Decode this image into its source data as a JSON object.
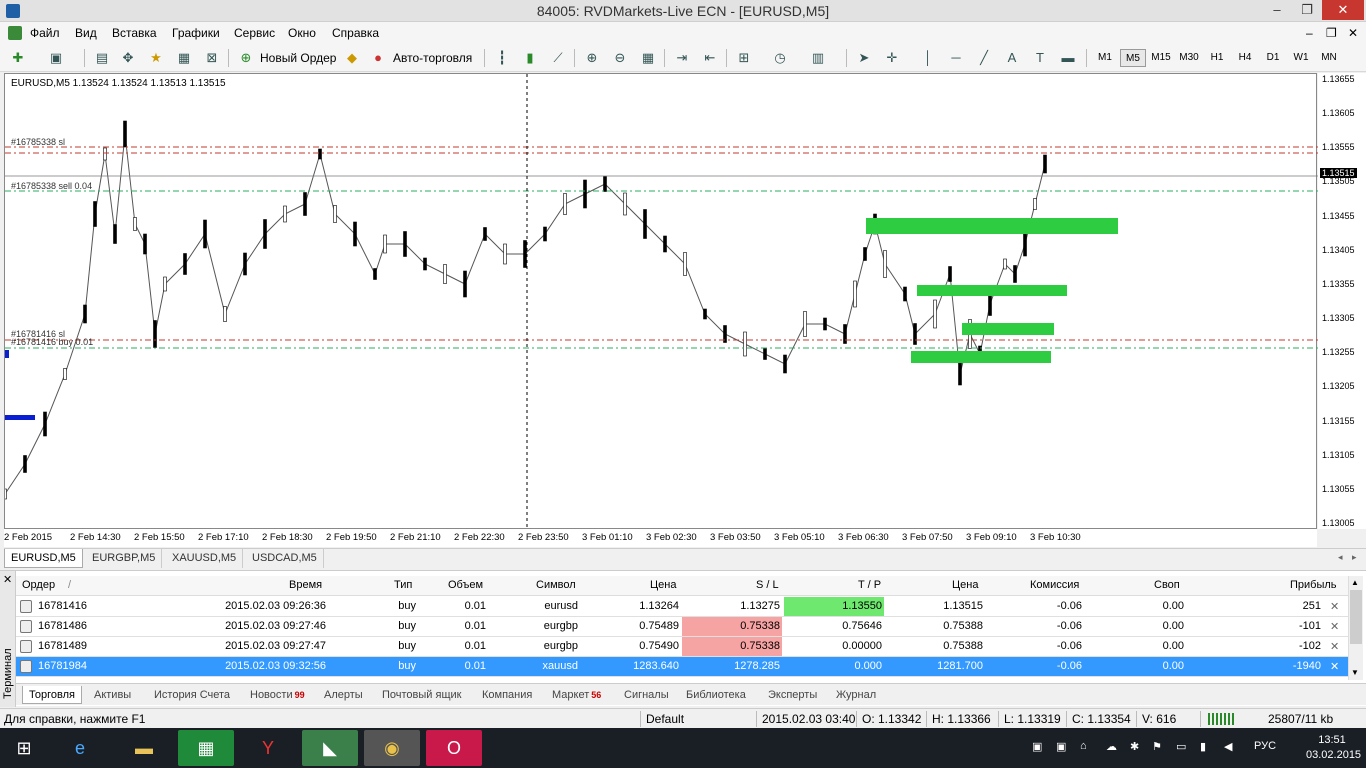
{
  "window": {
    "title": "84005: RVDMarkets-Live ECN - [EURUSD,M5]",
    "minimize": "–",
    "restore": "❐",
    "close": "✕"
  },
  "menu": [
    "Файл",
    "Вид",
    "Вставка",
    "Графики",
    "Сервис",
    "Окно",
    "Справка"
  ],
  "toolbar": {
    "new_order": "Новый Ордер",
    "auto_trading": "Авто-торговля",
    "timeframes": [
      "M1",
      "M5",
      "M15",
      "M30",
      "H1",
      "H4",
      "D1",
      "W1",
      "MN"
    ],
    "active_timeframe": "M5"
  },
  "chart": {
    "symbol_info": "EURUSD,M5  1.13524 1.13524 1.13513 1.13515",
    "current_price": "1.13515",
    "price_labels": [
      "1.13655",
      "1.13605",
      "1.13555",
      "1.13505",
      "1.13455",
      "1.13405",
      "1.13355",
      "1.13305",
      "1.13255",
      "1.13205",
      "1.13155",
      "1.13105",
      "1.13055",
      "1.13005"
    ],
    "time_labels": [
      "2 Feb 2015",
      "2 Feb 14:30",
      "2 Feb 15:50",
      "2 Feb 17:10",
      "2 Feb 18:30",
      "2 Feb 19:50",
      "2 Feb 21:10",
      "2 Feb 22:30",
      "2 Feb 23:50",
      "3 Feb 01:10",
      "3 Feb 02:30",
      "3 Feb 03:50",
      "3 Feb 05:10",
      "3 Feb 06:30",
      "3 Feb 07:50",
      "3 Feb 09:10",
      "3 Feb 10:30"
    ],
    "order_labels": [
      "#16785338 sl",
      "#16785338 sell 0.04",
      "#16781416 sl",
      "#16781416 buy 0.01"
    ],
    "colors": {
      "bull": "#000000",
      "bear": "#000000",
      "zone": "#2ecc40",
      "sl_line": "#c0392b",
      "entry_line": "#27ae60"
    }
  },
  "chart_tabs": [
    "EURUSD,M5",
    "EURGBP,M5",
    "XAUUSD,M5",
    "USDCAD,M5"
  ],
  "terminal": {
    "side_label": "Терминал",
    "columns": [
      "Ордер",
      "/",
      "Время",
      "Тип",
      "Объем",
      "Символ",
      "Цена",
      "S / L",
      "T / P",
      "Цена",
      "Комиссия",
      "Своп",
      "Прибыль"
    ],
    "rows": [
      {
        "order": "16781416",
        "time": "2015.02.03 09:26:36",
        "type": "buy",
        "volume": "0.01",
        "symbol": "eurusd",
        "price": "1.13264",
        "sl": "1.13275",
        "tp": "1.13550",
        "cur": "1.13515",
        "commission": "-0.06",
        "swap": "0.00",
        "profit": "251",
        "tp_hl": "green",
        "sl_hl": ""
      },
      {
        "order": "16781486",
        "time": "2015.02.03 09:27:46",
        "type": "buy",
        "volume": "0.01",
        "symbol": "eurgbp",
        "price": "0.75489",
        "sl": "0.75338",
        "tp": "0.75646",
        "cur": "0.75388",
        "commission": "-0.06",
        "swap": "0.00",
        "profit": "-101",
        "tp_hl": "",
        "sl_hl": "red"
      },
      {
        "order": "16781489",
        "time": "2015.02.03 09:27:47",
        "type": "buy",
        "volume": "0.01",
        "symbol": "eurgbp",
        "price": "0.75490",
        "sl": "0.75338",
        "tp": "0.00000",
        "cur": "0.75388",
        "commission": "-0.06",
        "swap": "0.00",
        "profit": "-102",
        "tp_hl": "",
        "sl_hl": "red"
      },
      {
        "order": "16781984",
        "time": "2015.02.03 09:32:56",
        "type": "buy",
        "volume": "0.01",
        "symbol": "xauusd",
        "price": "1283.640",
        "sl": "1278.285",
        "tp": "0.000",
        "cur": "1281.700",
        "commission": "-0.06",
        "swap": "0.00",
        "profit": "-1940",
        "tp_hl": "",
        "sl_hl": ""
      }
    ],
    "tabs": [
      {
        "label": "Торговля",
        "badge": ""
      },
      {
        "label": "Активы",
        "badge": ""
      },
      {
        "label": "История Счета",
        "badge": ""
      },
      {
        "label": "Новости",
        "badge": "99"
      },
      {
        "label": "Алерты",
        "badge": ""
      },
      {
        "label": "Почтовый ящик",
        "badge": ""
      },
      {
        "label": "Компания",
        "badge": ""
      },
      {
        "label": "Маркет",
        "badge": "56"
      },
      {
        "label": "Сигналы",
        "badge": ""
      },
      {
        "label": "Библиотека",
        "badge": ""
      },
      {
        "label": "Эксперты",
        "badge": ""
      },
      {
        "label": "Журнал",
        "badge": ""
      }
    ]
  },
  "status": {
    "help": "Для справки, нажмите F1",
    "profile": "Default",
    "datetime": "2015.02.03 03:40",
    "open": "O: 1.13342",
    "high": "H: 1.13366",
    "low": "L: 1.13319",
    "close": "C: 1.13354",
    "volume": "V: 616",
    "traffic": "25807/11 kb"
  },
  "taskbar": {
    "lang": "РУС",
    "time": "13:51",
    "date": "03.02.2015"
  }
}
